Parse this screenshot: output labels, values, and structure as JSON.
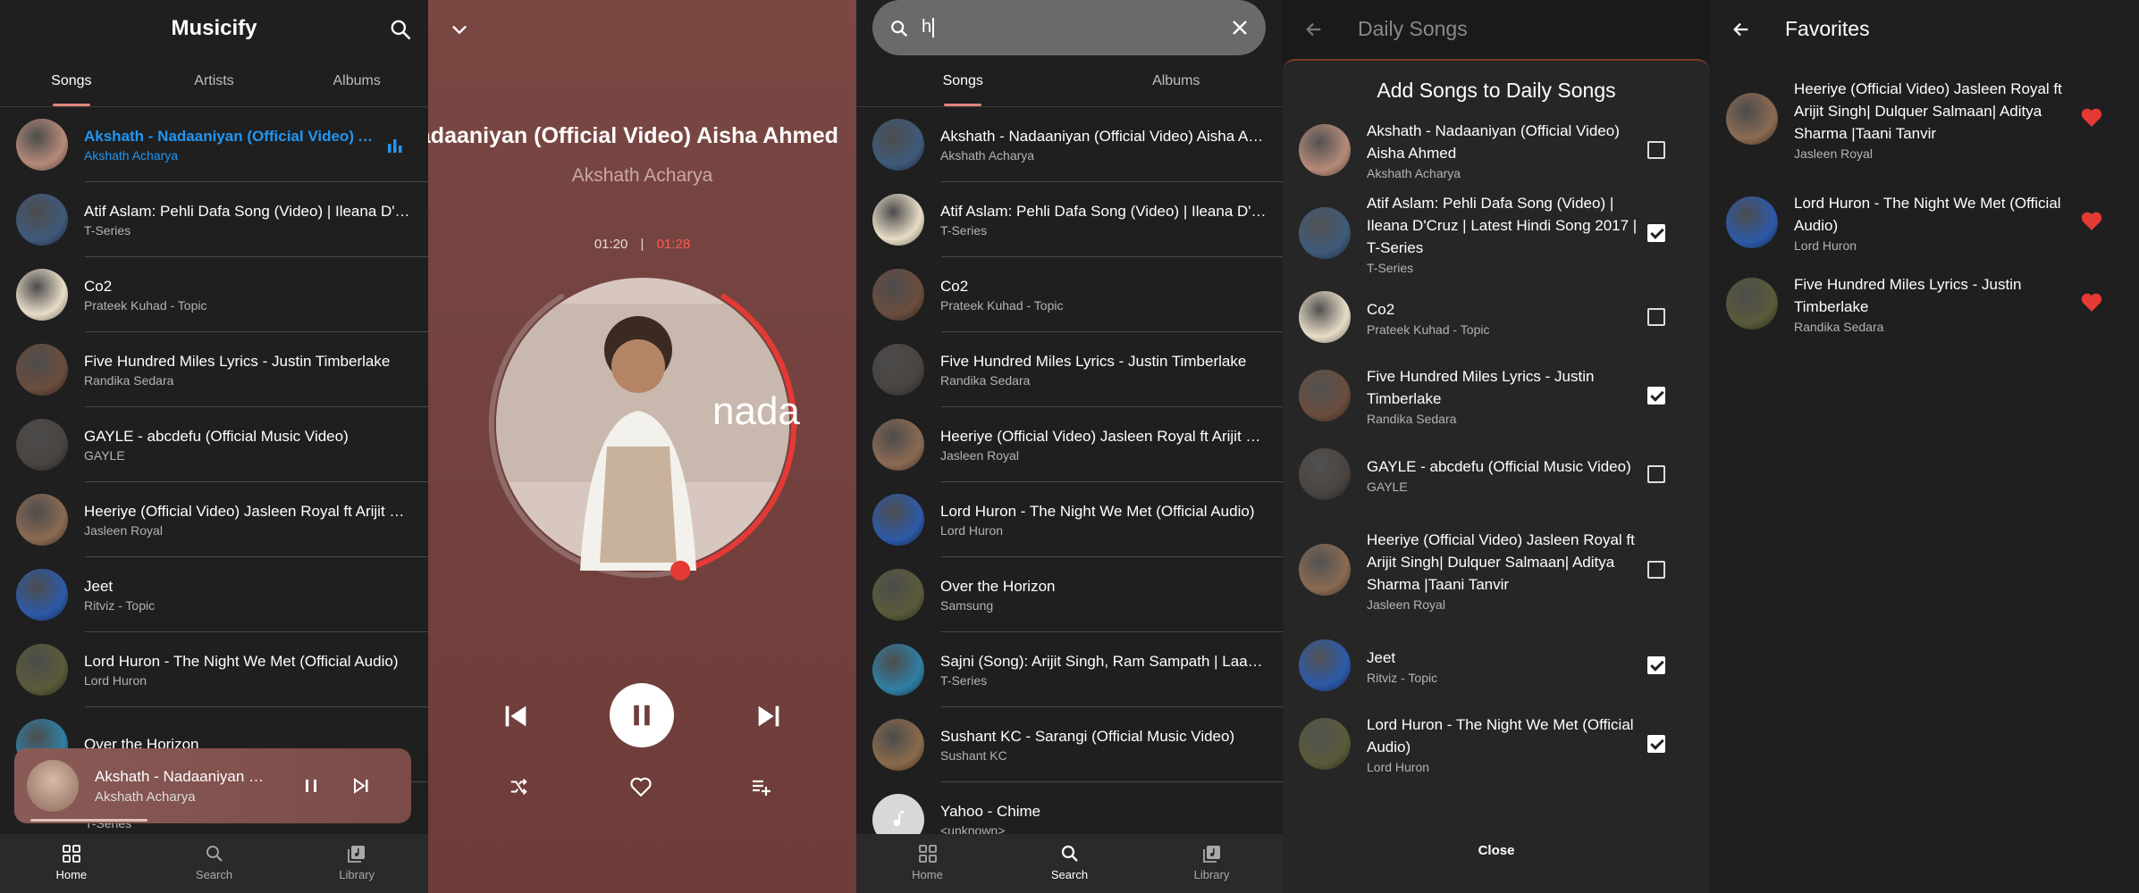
{
  "library": {
    "app_title": "Musicify",
    "tabs": [
      "Songs",
      "Artists",
      "Albums"
    ],
    "songs": [
      {
        "title": "Akshath - Nadaaniyan (Official Video) Aisha Ahmed",
        "artist": "Akshath Acharya",
        "playing": true
      },
      {
        "title": "Atif Aslam: Pehli Dafa Song (Video) | Ileana D'Cruz | Latest Hindi Song 2017 | T-Series",
        "artist": "T-Series"
      },
      {
        "title": "Co2",
        "artist": "Prateek Kuhad - Topic"
      },
      {
        "title": "Five Hundred Miles Lyrics -  Justin Timberlake",
        "artist": "Randika Sedara"
      },
      {
        "title": "GAYLE - abcdefu (Official Music Video)",
        "artist": "GAYLE"
      },
      {
        "title": "Heeriye (Official Video) Jasleen Royal ft Arijit Singh| Dulquer Salmaan| Aditya Sharma |Taani Tanvir",
        "artist": "Jasleen Royal"
      },
      {
        "title": "Jeet",
        "artist": "Ritviz - Topic"
      },
      {
        "title": "Lord Huron - The Night We Met (Official Audio)",
        "artist": "Lord Huron"
      },
      {
        "title": "Over the Horizon",
        "artist": ""
      }
    ],
    "hidden_artist": "T-Series",
    "mini_player": {
      "title": "Akshath - Nadaaniyan (Official Video) Aisha Ahmed",
      "artist": "Akshath Acharya",
      "progress": 0.31
    },
    "nav": [
      "Home",
      "Search",
      "Library"
    ],
    "accent": "#2196f3"
  },
  "player": {
    "title": "Akshath - Nadaaniyan (Official Video) Aisha Ahmed",
    "artist": "Akshath Acharya",
    "elapsed": "01:20",
    "separator": "|",
    "duration": "01:28",
    "progress": 0.91,
    "accent": "#e53935"
  },
  "search": {
    "query": "h",
    "tabs": [
      "Songs",
      "Albums"
    ],
    "results": [
      {
        "title": "Akshath - Nadaaniyan (Official Video) Aisha Ahmed",
        "artist": "Akshath Acharya"
      },
      {
        "title": "Atif Aslam: Pehli Dafa Song (Video) | Ileana D'Cruz | Latest Hindi Song 2017 | T-Series",
        "artist": "T-Series"
      },
      {
        "title": "Co2",
        "artist": "Prateek Kuhad - Topic"
      },
      {
        "title": "Five Hundred Miles Lyrics -  Justin Timberlake",
        "artist": "Randika Sedara"
      },
      {
        "title": "Heeriye (Official Video) Jasleen Royal ft Arijit Singh| Dulquer Salmaan| Aditya Sharma |Taani Tanvir",
        "artist": "Jasleen Royal"
      },
      {
        "title": "Lord Huron - The Night We Met (Official Audio)",
        "artist": "Lord Huron"
      },
      {
        "title": "Over the Horizon",
        "artist": "Samsung"
      },
      {
        "title": "Sajni (Song): Arijit Singh, Ram Sampath | Laapataa Ladies",
        "artist": "T-Series"
      },
      {
        "title": "Sushant KC - Sarangi (Official Music Video)",
        "artist": "Sushant KC"
      },
      {
        "title": "Yahoo - Chime",
        "artist": "<unknown>"
      }
    ],
    "nav": [
      "Home",
      "Search",
      "Library"
    ]
  },
  "playlist": {
    "title": "Daily Songs",
    "dialog_title": "Add Songs to Daily Songs",
    "items": [
      {
        "title": "Akshath - Nadaaniyan (Official Video) Aisha Ahmed",
        "artist": "Akshath Acharya",
        "checked": false
      },
      {
        "title": "Atif Aslam: Pehli Dafa Song (Video) | Ileana D'Cruz | Latest Hindi Song 2017 | T-Series",
        "artist": "T-Series",
        "checked": true
      },
      {
        "title": "Co2",
        "artist": "Prateek Kuhad - Topic",
        "checked": false
      },
      {
        "title": "Five Hundred Miles Lyrics -  Justin Timberlake",
        "artist": "Randika Sedara",
        "checked": true
      },
      {
        "title": "GAYLE - abcdefu (Official Music Video)",
        "artist": "GAYLE",
        "checked": false
      },
      {
        "title": "Heeriye (Official Video) Jasleen Royal ft Arijit Singh| Dulquer Salmaan| Aditya Sharma |Taani Tanvir",
        "artist": "Jasleen Royal",
        "checked": false
      },
      {
        "title": "Jeet",
        "artist": "Ritviz - Topic",
        "checked": true
      },
      {
        "title": "Lord Huron - The Night We Met (Official Audio)",
        "artist": "Lord Huron",
        "checked": true
      }
    ],
    "close_label": "Close"
  },
  "favorites": {
    "title": "Favorites",
    "items": [
      {
        "title": "Heeriye (Official Video) Jasleen Royal ft Arijit Singh| Dulquer Salmaan| Aditya Sharma |Taani Tanvir",
        "artist": "Jasleen Royal"
      },
      {
        "title": "Lord Huron - The Night We Met (Official Audio)",
        "artist": "Lord Huron"
      },
      {
        "title": "Five Hundred Miles Lyrics -  Justin Timberlake",
        "artist": "Randika Sedara"
      }
    ],
    "heart_color": "#e53935"
  }
}
